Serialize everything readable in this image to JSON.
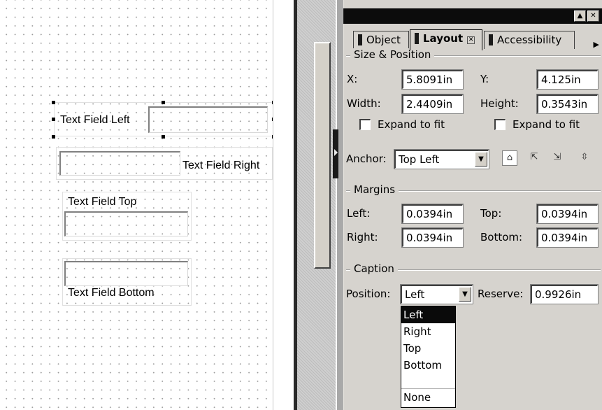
{
  "canvas": {
    "fields": [
      {
        "caption": "Text Field Left",
        "caption_position": "left"
      },
      {
        "caption": "Text Field Right",
        "caption_position": "right"
      },
      {
        "caption": "Text Field Top",
        "caption_position": "top"
      },
      {
        "caption": "Text Field Bottom",
        "caption_position": "bottom"
      }
    ]
  },
  "panel": {
    "titlebar": {
      "minimize_icon": "up-arrow-icon",
      "close_icon": "close-icon",
      "minimize_glyph": "▲",
      "close_glyph": "✕"
    },
    "tabs": [
      {
        "label": "Object",
        "active": false
      },
      {
        "label": "Layout",
        "active": true,
        "close_glyph": "✕"
      },
      {
        "label": "Accessibility",
        "active": false
      }
    ],
    "tabs_overflow_glyph": "▶",
    "size_position": {
      "title": "Size & Position",
      "x_label": "X:",
      "x_value": "5.8091in",
      "y_label": "Y:",
      "y_value": "4.125in",
      "width_label": "Width:",
      "width_value": "2.4409in",
      "height_label": "Height:",
      "height_value": "0.3543in",
      "expand_width_label": "Expand to fit",
      "expand_width_checked": false,
      "expand_height_label": "Expand to fit",
      "expand_height_checked": false,
      "anchor_label": "Anchor:",
      "anchor_value": "Top Left",
      "anchor_icons": [
        "anchor-top-left-icon",
        "anchor-top-right-icon",
        "anchor-bottom-left-icon",
        "anchor-bottom-right-icon"
      ]
    },
    "margins": {
      "title": "Margins",
      "left_label": "Left:",
      "left_value": "0.0394in",
      "top_label": "Top:",
      "top_value": "0.0394in",
      "right_label": "Right:",
      "right_value": "0.0394in",
      "bottom_label": "Bottom:",
      "bottom_value": "0.0394in"
    },
    "caption": {
      "title": "Caption",
      "position_label": "Position:",
      "position_value": "Left",
      "reserve_label": "Reserve:",
      "reserve_value": "0.9926in",
      "position_options": [
        "Left",
        "Right",
        "Top",
        "Bottom",
        "None"
      ],
      "highlighted_option": "Left"
    },
    "dropdown_arrow_glyph": "▼"
  },
  "colors": {
    "panel_bg": "#d6d3ce",
    "titlebar": "#0c0c0c",
    "selection": "#0a0a0a"
  }
}
